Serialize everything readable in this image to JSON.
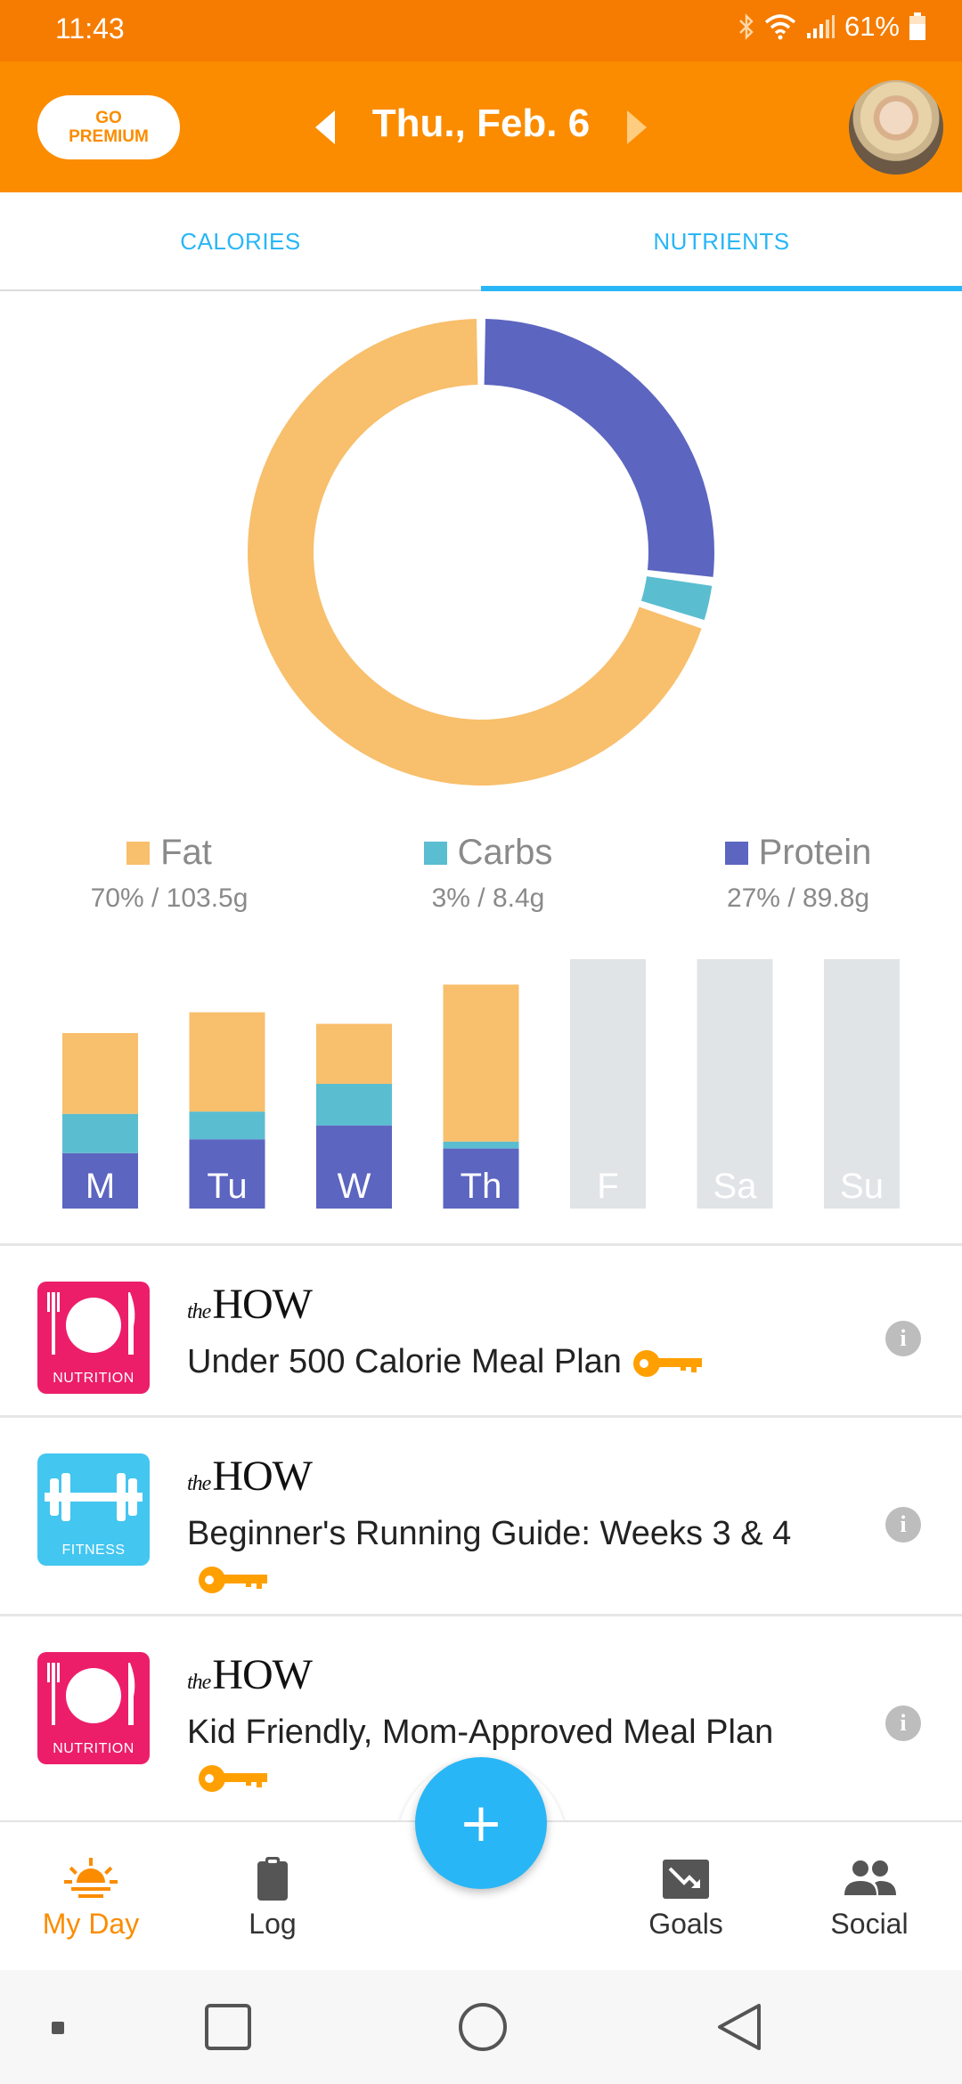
{
  "status_bar": {
    "time": "11:43",
    "battery": "61%"
  },
  "header": {
    "premium_line1": "GO",
    "premium_line2": "PREMIUM",
    "date": "Thu., Feb. 6"
  },
  "tabs": {
    "calories": "CALORIES",
    "nutrients": "NUTRIENTS",
    "active": "nutrients"
  },
  "colors": {
    "fat": "#F8BF6C",
    "carbs": "#5BBDD0",
    "protein": "#5C65C0",
    "empty": "#E1E4E6",
    "accent": "#FB8C00",
    "blue": "#29B6F6"
  },
  "chart_data": [
    {
      "type": "pie",
      "style": "donut",
      "categories": [
        "Fat",
        "Carbs",
        "Protein"
      ],
      "values": [
        70,
        3,
        27
      ],
      "legend": [
        {
          "name": "Fat",
          "value": "70% / 103.5g"
        },
        {
          "name": "Carbs",
          "value": "3% / 8.4g"
        },
        {
          "name": "Protein",
          "value": "27% / 89.8g"
        }
      ]
    },
    {
      "type": "bar",
      "stacked": true,
      "categories": [
        "M",
        "Tu",
        "W",
        "Th",
        "F",
        "Sa",
        "Su"
      ],
      "series": [
        {
          "name": "Protein",
          "values": [
            24,
            30,
            36,
            26,
            0,
            0,
            0
          ]
        },
        {
          "name": "Carbs",
          "values": [
            17,
            12,
            18,
            3,
            0,
            0,
            0
          ]
        },
        {
          "name": "Fat",
          "values": [
            35,
            43,
            26,
            68,
            0,
            0,
            0
          ]
        }
      ],
      "ylim": [
        0,
        108
      ]
    }
  ],
  "feed": [
    {
      "brand_prefix": "the",
      "brand": "HOW",
      "category": "NUTRITION",
      "title": "Under 500 Calorie Meal Plan"
    },
    {
      "brand_prefix": "the",
      "brand": "HOW",
      "category": "FITNESS",
      "title": "Beginner's Running Guide: Weeks 3 & 4"
    },
    {
      "brand_prefix": "the",
      "brand": "HOW",
      "category": "NUTRITION",
      "title": "Kid Friendly, Mom-Approved Meal Plan"
    }
  ],
  "fab": {
    "label": "+"
  },
  "bottom_nav": [
    {
      "label": "My Day",
      "icon": "sunrise-icon",
      "active": true
    },
    {
      "label": "Log",
      "icon": "clipboard-icon",
      "active": false
    },
    {
      "label": "Goals",
      "icon": "trend-down-icon",
      "active": false
    },
    {
      "label": "Social",
      "icon": "people-icon",
      "active": false
    }
  ]
}
